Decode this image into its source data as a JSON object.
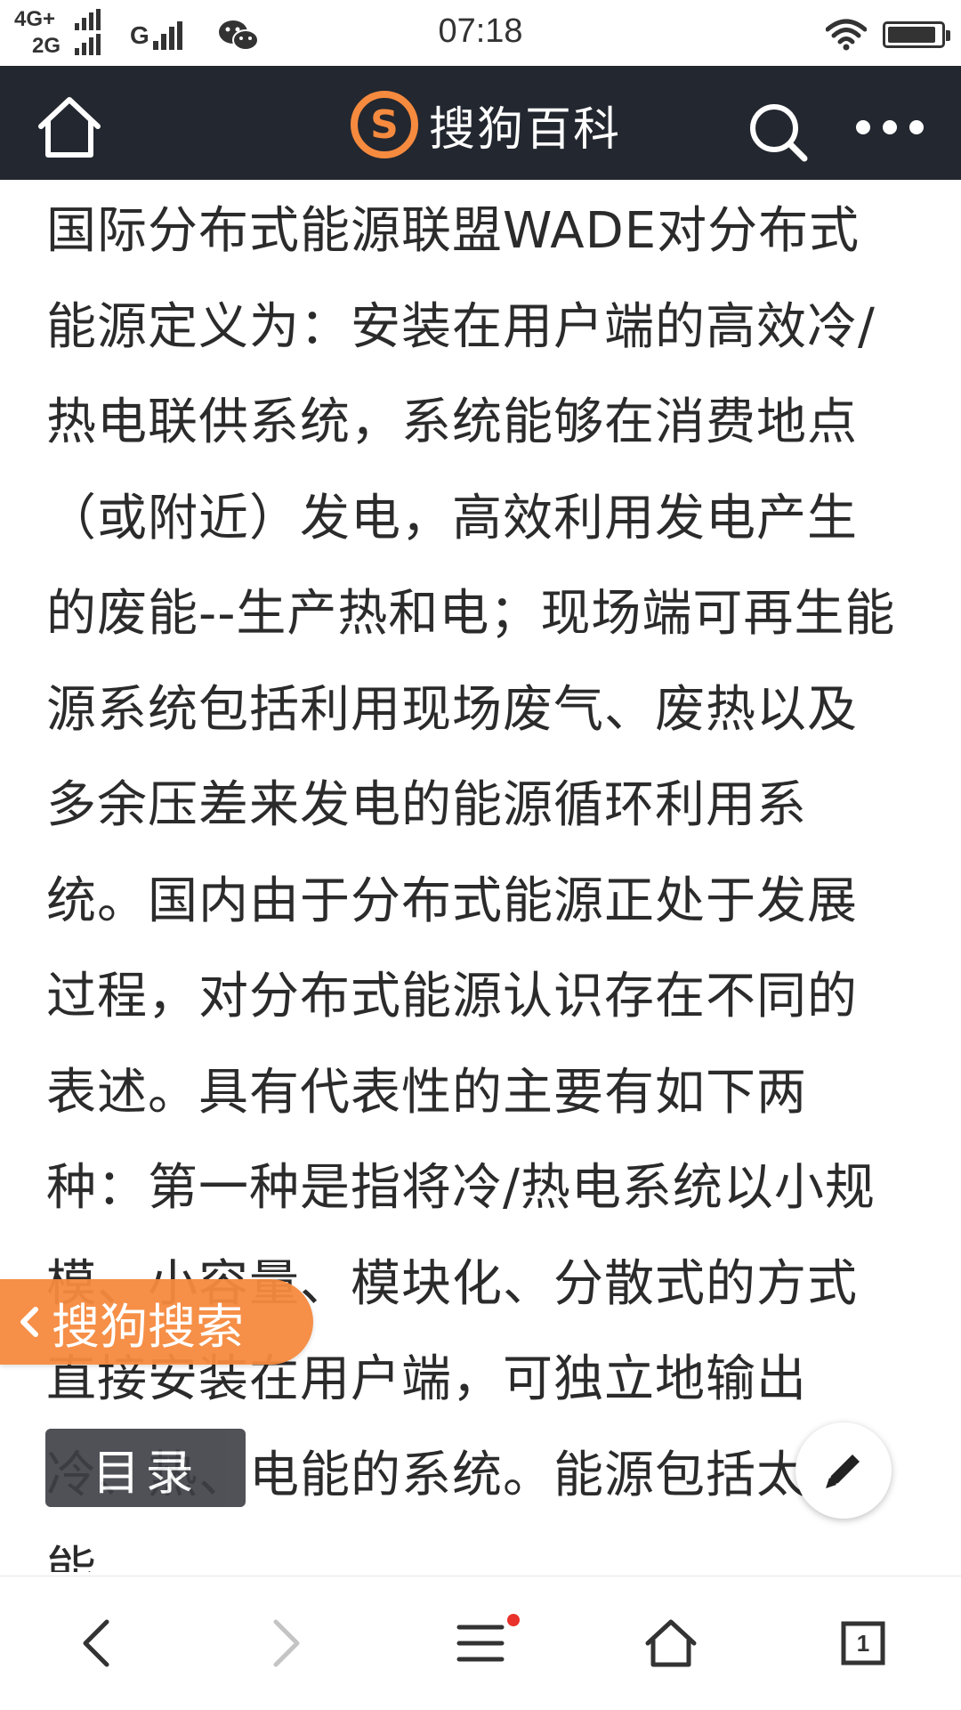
{
  "status_bar": {
    "time": "07:18",
    "sim1_network": "4G+",
    "sim2_network": "2G",
    "sim3_network": "G",
    "battery_level": 0.92
  },
  "header": {
    "logo_glyph": "S",
    "title": "搜狗百科"
  },
  "article": {
    "text": "国际分布式能源联盟WADE对分布式能源定义为：安装在用户端的高效冷/热电联供系统，系统能够在消费地点（或附近）发电，高效利用发电产生的废能--生产热和电；现场端可再生能源系统包括利用现场废气、废热以及多余压差来发电的能源循环利用系统。国内由于分布式能源正处于发展过程，对分布式能源认识存在不同的表述。具有代表性的主要有如下两种：第一种是指将冷/热电系统以小规模、小容量、模块化、分散式的方式直接安装在用户端，可独立地输出冷、热、电能的系统。能源包括太阳能"
  },
  "floating": {
    "search_label": "搜狗搜索",
    "toc_label": "目录"
  },
  "bottom_nav": {
    "tab_count": "1",
    "menu_has_notification": true
  },
  "colors": {
    "header_bg": "#23272f",
    "brand_orange": "#f68a3e",
    "badge_red": "#e8322b",
    "toc_bg": "#3d3f45"
  },
  "icons": [
    "home-icon",
    "search-icon",
    "more-icon",
    "back-arrow-icon",
    "forward-arrow-icon",
    "menu-icon",
    "home-outline-icon",
    "tabs-icon",
    "edit-pencil-icon",
    "chevron-left-icon",
    "wifi-icon",
    "wechat-icon",
    "battery-icon"
  ]
}
